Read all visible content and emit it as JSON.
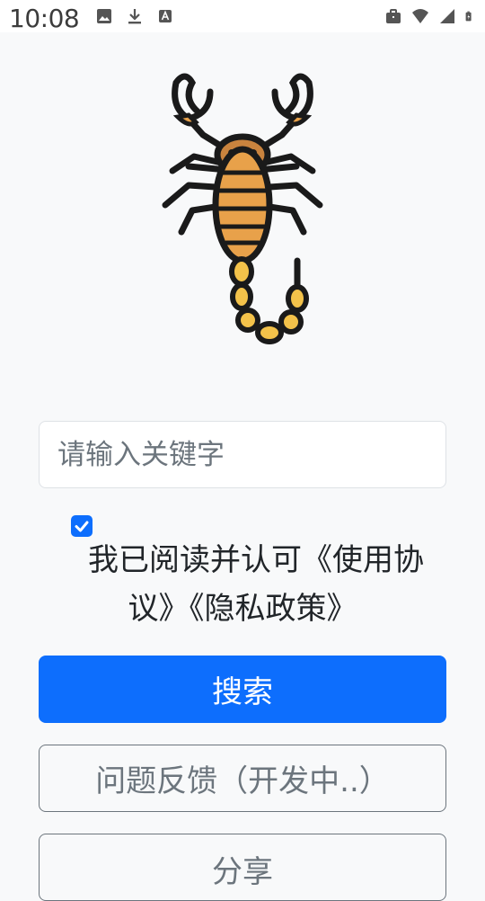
{
  "status_bar": {
    "time": "10:08",
    "left_icons": [
      "image-icon",
      "download-icon",
      "font-icon"
    ],
    "right_icons": [
      "briefcase-icon",
      "wifi-icon",
      "signal-icon",
      "battery-icon"
    ]
  },
  "logo": {
    "icon": "scorpion-icon"
  },
  "search": {
    "placeholder": "请输入关键字",
    "value": ""
  },
  "agreement": {
    "checked": true,
    "text": "我已阅读并认可《使用协议》《隐私政策》"
  },
  "buttons": {
    "search_label": "搜索",
    "feedback_label": "问题反馈（开发中..）",
    "share_label": "分享"
  },
  "colors": {
    "primary": "#0d6efd",
    "secondary": "#6c757d",
    "background": "#f8f9fa"
  }
}
